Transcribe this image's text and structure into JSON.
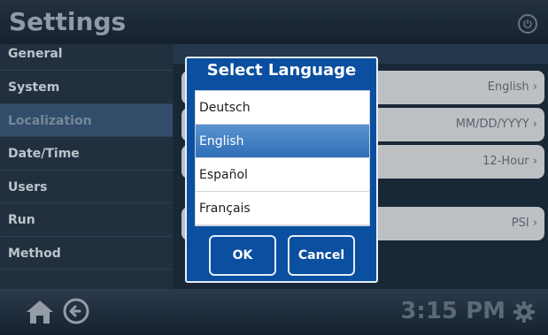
{
  "header": {
    "title": "Settings"
  },
  "sidebar": {
    "items": [
      {
        "label": "General",
        "active": false
      },
      {
        "label": "System",
        "active": false
      },
      {
        "label": "Localization",
        "active": true
      },
      {
        "label": "Date/Time",
        "active": false
      },
      {
        "label": "Users",
        "active": false
      },
      {
        "label": "Run",
        "active": false
      },
      {
        "label": "Method",
        "active": false
      }
    ]
  },
  "content": {
    "rows": [
      {
        "value": "English ›"
      },
      {
        "value": "MM/DD/YYYY ›"
      },
      {
        "value": "12-Hour ›"
      },
      {
        "value": "PSI ›"
      }
    ]
  },
  "footer": {
    "clock": "3:15 PM"
  },
  "dialog": {
    "title": "Select Language",
    "options": [
      "Deutsch",
      "English",
      "Español",
      "Français"
    ],
    "selected": "English",
    "ok_label": "OK",
    "cancel_label": "Cancel"
  },
  "colors": {
    "dialog_bg": "#0a4fa0",
    "selection": "#2f6fb6",
    "sidebar_active": "#3a5b7c"
  },
  "icons": [
    "power-icon",
    "home-icon",
    "back-arrow-icon",
    "gear-icon"
  ]
}
